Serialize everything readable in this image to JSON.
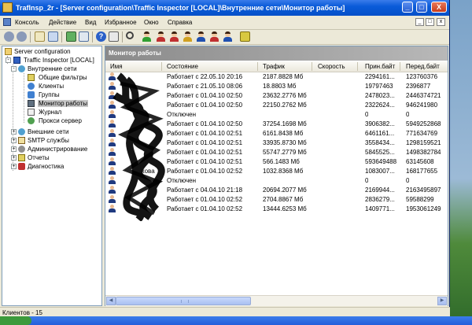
{
  "window": {
    "title": "TrafInsp_2r - [Server configuration\\Traffic Inspector [LOCAL]\\Внутренние сети\\Монитор работы]",
    "controls": [
      "_",
      "□",
      "X"
    ]
  },
  "menu": {
    "items": [
      "Консоль",
      "Действие",
      "Вид",
      "Избранное",
      "Окно",
      "Справка"
    ],
    "mdi_controls": [
      "_",
      "□",
      "x"
    ]
  },
  "toolbar": {
    "icons": [
      "back-icon",
      "forward-icon",
      "up-icon",
      "refresh-icon",
      "export-icon",
      "help-icon",
      "properties-icon",
      "search-icon",
      "user-icon",
      "filter-icon"
    ],
    "colors": {
      "accent": "#0a5bd9",
      "selected": "#c6c6c6"
    }
  },
  "tree": {
    "root": "Server configuration",
    "items": [
      {
        "label": "Traffic Inspector [LOCAL]"
      },
      {
        "label": "Внутренние сети"
      },
      {
        "label": "Общие фильтры"
      },
      {
        "label": "Клиенты"
      },
      {
        "label": "Группы"
      },
      {
        "label": "Монитор работы"
      },
      {
        "label": "Журнал"
      },
      {
        "label": "Прокси сервер"
      },
      {
        "label": "Внешние сети"
      },
      {
        "label": "SMTP службы"
      },
      {
        "label": "Администрирование"
      },
      {
        "label": "Отчеты"
      },
      {
        "label": "Диагностика"
      }
    ],
    "selected": "Монитор работы"
  },
  "panel": {
    "title": "Монитор работы",
    "columns": [
      "Имя",
      "Состояние",
      "Трафик",
      "Скорость",
      "Прин.байт",
      "Перед.байт"
    ],
    "rows": [
      {
        "name": "",
        "status": "Работает с 22.05.10 20:16",
        "traffic": "2187.8828 Мб",
        "speed": "",
        "recv": "2294161...",
        "sent": "123760376"
      },
      {
        "name": "",
        "status": "Работает с 21.05.10 08:06",
        "traffic": "18.8803 Мб",
        "speed": "",
        "recv": "19797463",
        "sent": "2396877"
      },
      {
        "name": "",
        "status": "Работает с 01.04.10 02:50",
        "traffic": "23632.2776 Мб",
        "speed": "",
        "recv": "2478023...",
        "sent": "2446374721"
      },
      {
        "name": "",
        "status": "Работает с 01.04.10 02:50",
        "traffic": "22150.2762 Мб",
        "speed": "",
        "recv": "2322624...",
        "sent": "946241980"
      },
      {
        "name": "",
        "status": "Отключен",
        "traffic": "",
        "speed": "",
        "recv": "0",
        "sent": "0"
      },
      {
        "name": "",
        "status": "Работает с 01.04.10 02:50",
        "traffic": "37254.1698 Мб",
        "speed": "",
        "recv": "3906382...",
        "sent": "5949252868"
      },
      {
        "name": "",
        "status": "Работает с 01.04.10 02:51",
        "traffic": "6161.8438 Мб",
        "speed": "",
        "recv": "6461161...",
        "sent": "771634769"
      },
      {
        "name": "",
        "status": "Работает с 01.04.10 02:51",
        "traffic": "33935.8730 Мб",
        "speed": "",
        "recv": "3558434...",
        "sent": "1298159521"
      },
      {
        "name": "",
        "status": "Работает с 01.04.10 02:51",
        "traffic": "55747.2779 Мб",
        "speed": "",
        "recv": "5845525...",
        "sent": "1498382784"
      },
      {
        "name": "",
        "status": "Работает с 01.04.10 02:51",
        "traffic": "566.1483 Мб",
        "speed": "",
        "recv": "593649488",
        "sent": "63145608"
      },
      {
        "name": "кова",
        "status": "Работает с 01.04.10 02:52",
        "traffic": "1032.8368 Мб",
        "speed": "",
        "recv": "1083007...",
        "sent": "168177655"
      },
      {
        "name": "",
        "status": "Отключен",
        "traffic": "",
        "speed": "",
        "recv": "0",
        "sent": "0"
      },
      {
        "name": "",
        "status": "Работает с 04.04.10 21:18",
        "traffic": "20694.2077 Мб",
        "speed": "",
        "recv": "2169944...",
        "sent": "2163495897"
      },
      {
        "name": "",
        "status": "Работает с 01.04.10 02:52",
        "traffic": "2704.8867 Мб",
        "speed": "",
        "recv": "2836279...",
        "sent": "59588299"
      },
      {
        "name": "",
        "status": "Работает с 01.04.10 02:52",
        "traffic": "13444.6253 Мб",
        "speed": "",
        "recv": "1409771...",
        "sent": "1953061249"
      }
    ]
  },
  "status_bar": {
    "text": "Клиентов - 15"
  }
}
